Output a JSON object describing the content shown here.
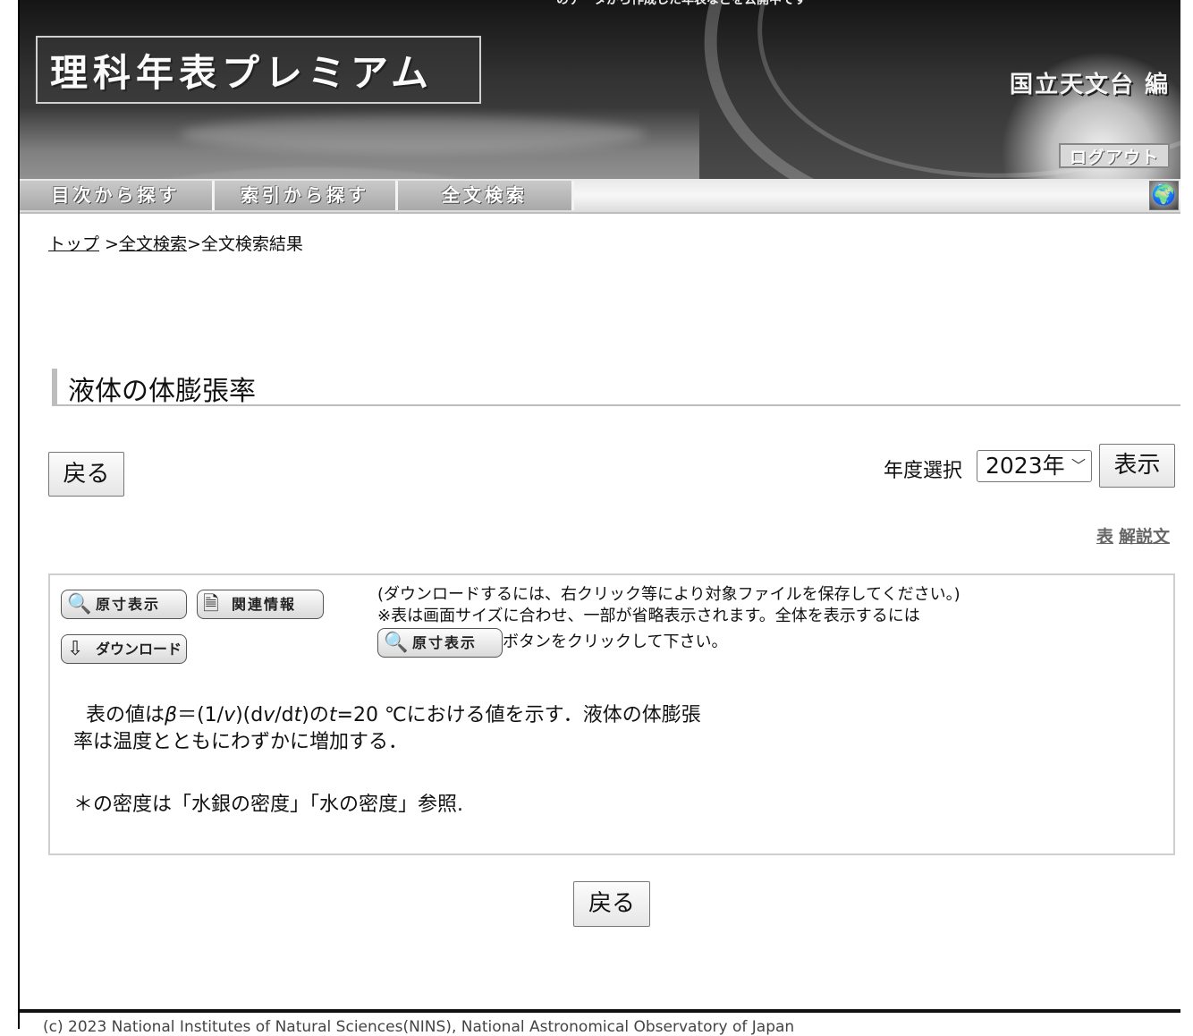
{
  "header": {
    "top_strip": "のデータから作成した年表などを公開中です",
    "app_title": "理科年表プレミアム",
    "editor": "国立天文台 編",
    "logout_label": "ログアウト"
  },
  "nav": {
    "tabs": [
      {
        "label": "目次から探す"
      },
      {
        "label": "索引から探す"
      },
      {
        "label": "全文検索"
      }
    ],
    "globe_icon": "globe-icon"
  },
  "breadcrumb": {
    "top": "トップ",
    "sep1": " >",
    "search": "全文検索",
    "sep2": ">",
    "current": "全文検索結果"
  },
  "page": {
    "title": "液体の体膨張率",
    "back_label": "戻る",
    "year_label": "年度選択",
    "year_value": "2023年",
    "show_label": "表示",
    "view_links": [
      "表",
      "解説文"
    ]
  },
  "tools": {
    "zoom_label": "原寸表示",
    "related_label": "関連情報",
    "download_label": "ダウンロード",
    "download_note": "(ダウンロードするには、右クリック等により対象ファイルを保存してください。)",
    "display_note": "※表は画面サイズに合わせ、一部が省略表示されます。全体を表示するには",
    "display_note_tail": "ボタンをクリックして下さい。"
  },
  "description": {
    "lead": "表の値は",
    "beta": "β",
    "formula_a": "＝(1/",
    "v1": "v",
    "formula_b": ")(d",
    "v2": "v",
    "formula_c": "/d",
    "t1": "t",
    "formula_d": ")の",
    "t2": "t",
    "formula_e": "=20 ℃における値を示す．液体の体膨張",
    "line2": "率は温度とともにわずかに増加する．",
    "note": "＊の密度は「水銀の密度」「水の密度」参照."
  },
  "footer": {
    "copyright": "(c) 2023 National Institutes of Natural Sciences(NINS), National Astronomical Observatory of Japan"
  },
  "colors": {
    "accent_gray": "#bdbdbd",
    "text": "#111111"
  }
}
